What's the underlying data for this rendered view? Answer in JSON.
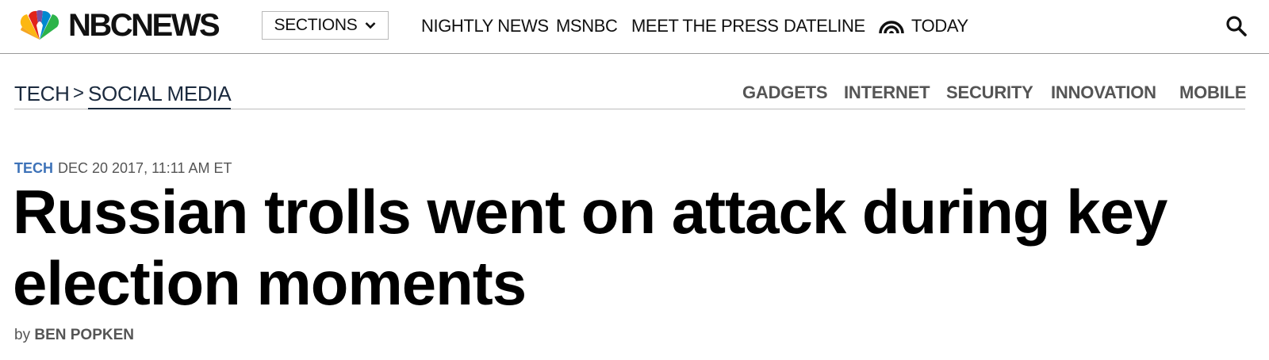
{
  "brand": {
    "name": "NBCNEWS",
    "peacock_colors": [
      "#f5a623",
      "#e2231a",
      "#7b4fa0",
      "#0089d0",
      "#2cb34a",
      "#fcb711"
    ]
  },
  "topnav": {
    "sections_label": "SECTIONS",
    "links": [
      "NIGHTLY NEWS",
      "MSNBC",
      "MEET THE PRESS",
      "DATELINE",
      "TODAY"
    ],
    "search_icon": "search-icon",
    "today_icon": "sunrise-icon"
  },
  "subnav": {
    "breadcrumb": [
      "TECH",
      "SOCIAL MEDIA"
    ],
    "separator": ">",
    "links": [
      "GADGETS",
      "INTERNET",
      "SECURITY",
      "INNOVATION",
      "MOBILE"
    ]
  },
  "article": {
    "category": "TECH",
    "date": "DEC 20 2017, 11:11 AM ET",
    "headline": "Russian trolls went on attack during key election moments",
    "by": "by",
    "author": "BEN POPKEN"
  },
  "colors": {
    "category_blue": "#3d72b8",
    "breadcrumb_navy": "#1b2a3e",
    "subnav_gray": "#555555"
  }
}
